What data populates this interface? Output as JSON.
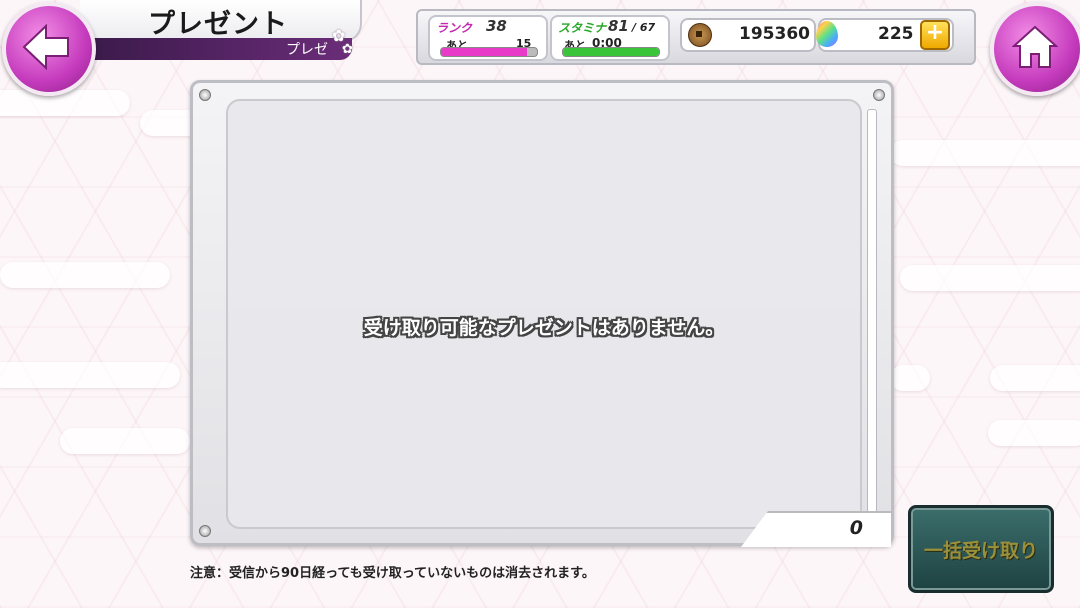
{
  "header": {
    "title": "プレゼント",
    "subtitle": "プレゼ",
    "back_icon": "back-arrow-icon",
    "home_icon": "home-icon"
  },
  "status": {
    "rank_label": "ランク",
    "rank_value": "38",
    "rank_next_label": "あと",
    "rank_next_value": "15",
    "rank_progress": 0.9,
    "stamina_label": "スタミナ",
    "stamina_value": "81",
    "stamina_max": "/ 67",
    "stamina_next_label": "あと",
    "stamina_timer": "0:00",
    "stamina_progress": 1.0,
    "coins": "195360",
    "gems": "225",
    "plus_label": "+"
  },
  "panel": {
    "empty_message": "受け取り可能なプレゼントはありません。",
    "count": "0"
  },
  "footer": {
    "note": "注意：受信から90日経っても受け取っていないものは消去されます。",
    "receive_all_label": "一括受け取り"
  },
  "colors": {
    "accent_magenta": "#c53bbd",
    "rank_bar": "#e83bc8",
    "stamina_bar": "#3ac43a",
    "receive_all_bg": "#2c5755"
  }
}
